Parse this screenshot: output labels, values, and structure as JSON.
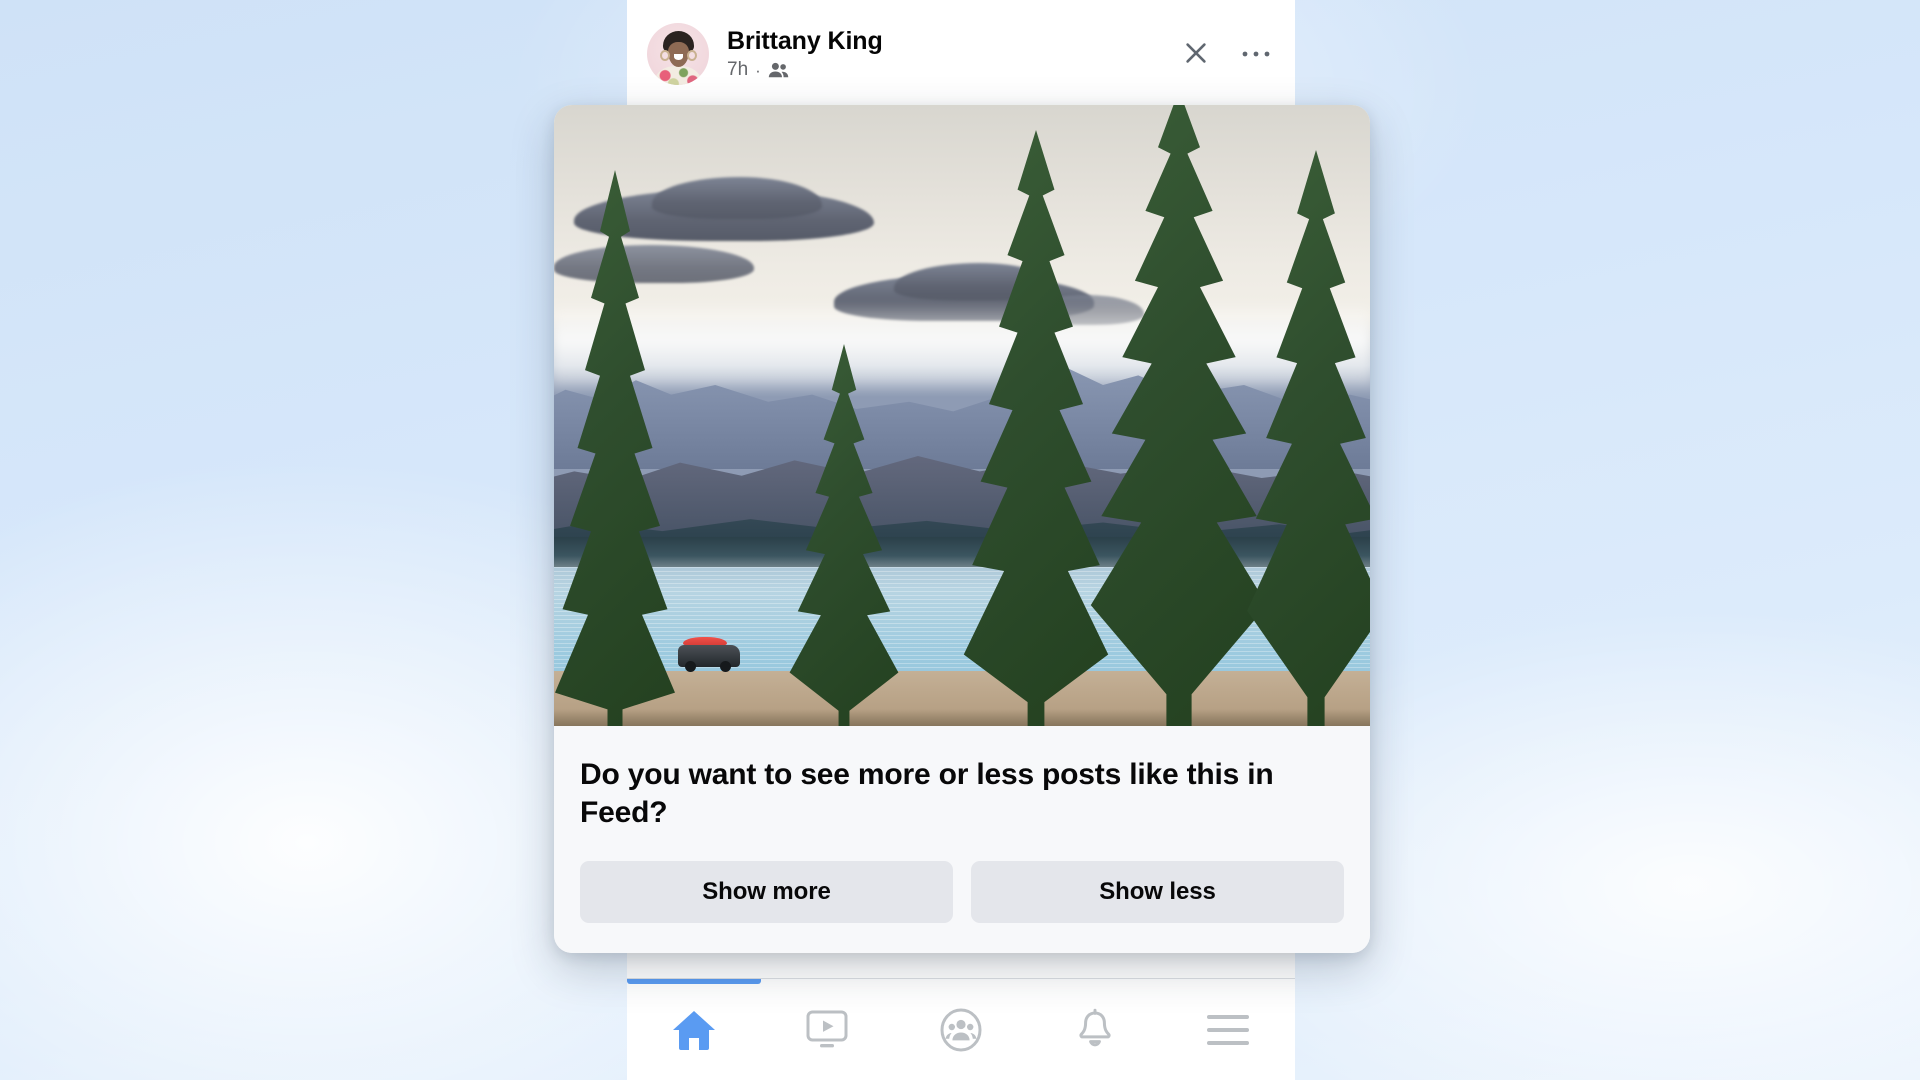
{
  "app": {
    "accent_color": "#5a9bf2",
    "surface_color": "#ffffff",
    "dialog_bg_color": "#f7f8fa",
    "button_bg_color": "#e4e6eb"
  },
  "post": {
    "author_name": "Brittany King",
    "timestamp": "7h",
    "separator": "·",
    "audience_icon": "friends-icon",
    "avatar_icon": "avatar",
    "close_icon": "close-icon",
    "more_icon": "more-options-icon"
  },
  "dialog": {
    "photo_alt": "scenic-lake-photo",
    "question": "Do you want to see more or less posts like this in Feed?",
    "actions": [
      {
        "id": "show-more",
        "label": "Show more"
      },
      {
        "id": "show-less",
        "label": "Show less"
      }
    ]
  },
  "bottom_nav": {
    "items": [
      {
        "id": "home",
        "icon": "home-icon",
        "active": true
      },
      {
        "id": "watch",
        "icon": "watch-icon",
        "active": false
      },
      {
        "id": "groups",
        "icon": "groups-icon",
        "active": false
      },
      {
        "id": "notifications",
        "icon": "bell-icon",
        "active": false
      },
      {
        "id": "menu",
        "icon": "hamburger-menu-icon",
        "active": false
      }
    ]
  }
}
